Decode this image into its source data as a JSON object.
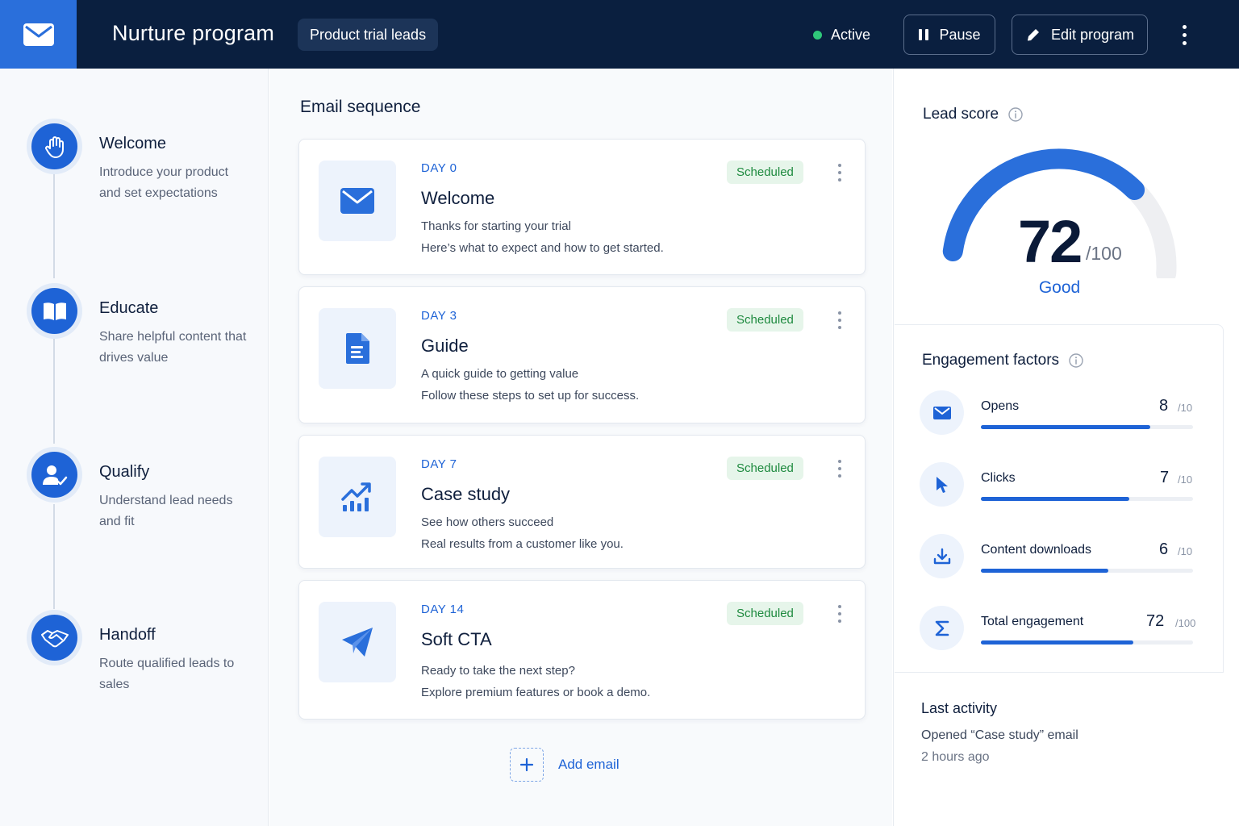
{
  "header": {
    "title": "Nurture program",
    "segment": "Product trial leads",
    "status": "Active",
    "pause_label": "Pause",
    "edit_label": "Edit program"
  },
  "stages": [
    {
      "title": "Welcome",
      "description": "Introduce your product and set expectations",
      "icon": "wave-hand-icon"
    },
    {
      "title": "Educate",
      "description": "Share helpful content that drives value",
      "icon": "book-icon"
    },
    {
      "title": "Qualify",
      "description": "Understand lead needs and fit",
      "icon": "user-check-icon"
    },
    {
      "title": "Handoff",
      "description": "Route qualified leads to sales",
      "icon": "handshake-icon"
    }
  ],
  "sequence": {
    "title": "Email sequence",
    "emails": [
      {
        "day": "DAY 0",
        "title": "Welcome",
        "line1": "Thanks for starting your trial",
        "line2": "Here’s what to expect and how to get started.",
        "status": "Scheduled",
        "icon": "mail-icon"
      },
      {
        "day": "DAY 3",
        "title": "Guide",
        "line1": "A quick guide to getting value",
        "line2": "Follow these steps to set up for success.",
        "status": "Scheduled",
        "icon": "document-icon"
      },
      {
        "day": "DAY 7",
        "title": "Case study",
        "line1": "See how others succeed",
        "line2": "Real results from a customer like you.",
        "status": "Scheduled",
        "icon": "trend-chart-icon"
      },
      {
        "day": "DAY 14",
        "title": "Soft CTA",
        "line1": "Ready to take the next step?",
        "line2": "Explore premium features or book a demo.",
        "status": "Scheduled",
        "icon": "paper-plane-icon"
      }
    ],
    "add_label": "Add email"
  },
  "lead_score": {
    "heading": "Lead score",
    "score": "72",
    "max": "/100",
    "fraction": 0.72,
    "label": "Good"
  },
  "engagement": {
    "heading": "Engagement factors",
    "factors": [
      {
        "name": "Opens",
        "value": "8",
        "max": "/10",
        "fraction": 0.8,
        "icon": "mail-icon"
      },
      {
        "name": "Clicks",
        "value": "7",
        "max": "/10",
        "fraction": 0.7,
        "icon": "cursor-icon"
      },
      {
        "name": "Content downloads",
        "value": "6",
        "max": "/10",
        "fraction": 0.6,
        "icon": "download-icon"
      },
      {
        "name": "Total engagement",
        "value": "72",
        "max": "/100",
        "fraction": 0.72,
        "icon": "sigma-icon"
      }
    ]
  },
  "last_activity": {
    "heading": "Last activity",
    "text": "Opened “Case study” email",
    "time": "2 hours ago"
  },
  "colors": {
    "header_bg": "#0a1f3f",
    "accent": "#1e63d6",
    "active_dot": "#2fc77a",
    "badge_bg": "#e6f5ea",
    "badge_text": "#1e8a3f"
  }
}
